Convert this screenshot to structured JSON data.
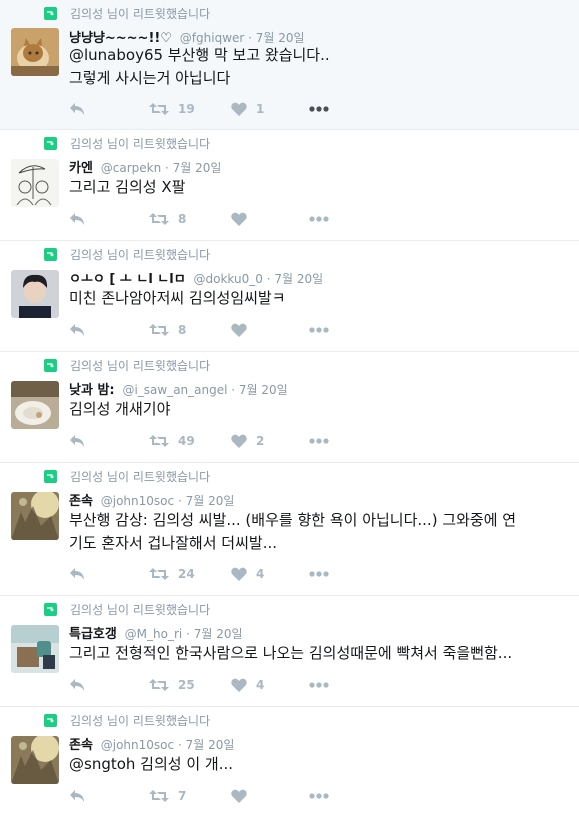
{
  "tweets": [
    {
      "retweeter": "김의성 님이 리트윗했습니다",
      "name": "냥냥냥~~~~!!♡",
      "handle": "@fghiqwer",
      "date": "7월 20일",
      "lines": [
        "@lunaboy65 부산행 막 보고 왔습니다..",
        "그렇게 사시는거 아닙니다"
      ],
      "retweets": "19",
      "likes": "1"
    },
    {
      "retweeter": "김의성 님이 리트윗했습니다",
      "name": "카엔",
      "handle": "@carpekn",
      "date": "7월 20일",
      "lines": [
        "그리고 김의성 X팔"
      ],
      "retweets": "8",
      "likes": ""
    },
    {
      "retweeter": "김의성 님이 리트윗했습니다",
      "name": "ㅇㅗㅇ [ ㅗ ㄴl ㄴlㅁ",
      "handle": "@dokku0_0",
      "date": "7월 20일",
      "lines": [
        "미친 존나암아저씨 김의성임씨발ㅋ"
      ],
      "retweets": "8",
      "likes": ""
    },
    {
      "retweeter": "김의성 님이 리트윗했습니다",
      "name": "낮과 밤:",
      "handle": "@i_saw_an_angel",
      "date": "7월 20일",
      "lines": [
        "김의성 개새기야"
      ],
      "retweets": "49",
      "likes": "2"
    },
    {
      "retweeter": "김의성 님이 리트윗했습니다",
      "name": "존속",
      "handle": "@john10soc",
      "date": "7월 20일",
      "lines": [
        "부산행 감상: 김의성 씨발... (배우를 향한 욕이 아닙니다...) 그와중에 연",
        "기도 혼자서 겁나잘해서 더씨발..."
      ],
      "retweets": "24",
      "likes": "4"
    },
    {
      "retweeter": "김의성 님이 리트윗했습니다",
      "name": "특급호갱",
      "handle": "@M_ho_ri",
      "date": "7월 20일",
      "lines": [
        "그리고 전형적인 한국사람으로 나오는 김의성때문에 빡쳐서 죽을뻔함..."
      ],
      "retweets": "25",
      "likes": "4"
    },
    {
      "retweeter": "김의성 님이 리트윗했습니다",
      "name": "존속",
      "handle": "@john10soc",
      "date": "7월 20일",
      "lines": [
        "@sngtoh 김의성 이 개..."
      ],
      "retweets": "7",
      "likes": ""
    }
  ],
  "colors": {
    "retweet_badge": "#19cf86",
    "meta_gray": "#8899a6",
    "icon_gray": "#aab8c2",
    "highlight_bg": "#f5f8fa"
  },
  "icons": {
    "reply": "reply-icon",
    "retweet": "retweet-icon",
    "like": "heart-icon",
    "more": "more-dots-icon",
    "retweet_context": "retweet-badge-icon"
  }
}
